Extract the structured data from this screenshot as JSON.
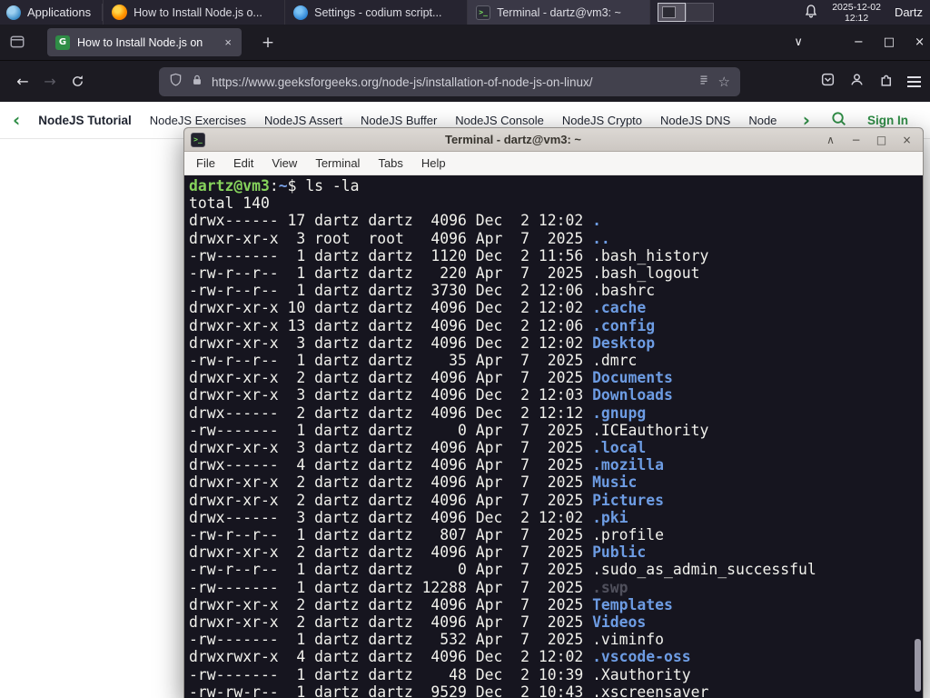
{
  "colors": {
    "gfg_green": "#2f8d46",
    "dir_blue": "#6d9ce3",
    "prompt_green": "#86d35c",
    "firefox_orange": "#ff9500",
    "terminal_bg": "#16151f"
  },
  "panel": {
    "applications": "Applications",
    "tasks": [
      {
        "title": "How to Install Node.js o...",
        "icon": "firefox"
      },
      {
        "title": "Settings - codium script...",
        "icon": "codium"
      },
      {
        "title": "Terminal - dartz@vm3: ~",
        "icon": "terminal"
      }
    ],
    "clock": {
      "date": "2025-12-02",
      "time": "12:12"
    },
    "user": "Dartz"
  },
  "browser": {
    "tab": {
      "title": "How to Install Node.js on",
      "close": "×"
    },
    "new_tab": "+",
    "window_controls": {
      "list_tabs": "∨",
      "minimize": "−",
      "maximize": "□",
      "close": "×"
    },
    "nav": {
      "back": "←",
      "forward": "→"
    },
    "url": "https://www.geeksforgeeks.org/node-js/installation-of-node-js-on-linux/",
    "star": "☆"
  },
  "gfg": {
    "chevron_left": "‹",
    "chevron_right": "›",
    "items": [
      {
        "label": "NodeJS Tutorial",
        "bold": true
      },
      {
        "label": "NodeJS Exercises"
      },
      {
        "label": "NodeJS Assert"
      },
      {
        "label": "NodeJS Buffer"
      },
      {
        "label": "NodeJS Console"
      },
      {
        "label": "NodeJS Crypto"
      },
      {
        "label": "NodeJS DNS"
      },
      {
        "label": "Node"
      }
    ],
    "sign_in": "Sign In"
  },
  "terminal": {
    "title": "Terminal - dartz@vm3: ~",
    "window_buttons": {
      "shade": "∧",
      "minimize": "−",
      "maximize": "□",
      "close": "×"
    },
    "menu": [
      "File",
      "Edit",
      "View",
      "Terminal",
      "Tabs",
      "Help"
    ],
    "prompt": {
      "user": "dartz@vm3",
      "colon": ":",
      "path": "~",
      "dollar": "$ ",
      "command": "ls -la"
    },
    "total": "total 140",
    "entries": [
      {
        "m": "drwx------ 17 dartz dartz  4096 Dec  2 12:02 ",
        "n": ".",
        "k": "dir"
      },
      {
        "m": "drwxr-xr-x  3 root  root   4096 Apr  7  2025 ",
        "n": "..",
        "k": "dir"
      },
      {
        "m": "-rw-------  1 dartz dartz  1120 Dec  2 11:56 ",
        "n": ".bash_history",
        "k": "file"
      },
      {
        "m": "-rw-r--r--  1 dartz dartz   220 Apr  7  2025 ",
        "n": ".bash_logout",
        "k": "file"
      },
      {
        "m": "-rw-r--r--  1 dartz dartz  3730 Dec  2 12:06 ",
        "n": ".bashrc",
        "k": "file"
      },
      {
        "m": "drwxr-xr-x 10 dartz dartz  4096 Dec  2 12:02 ",
        "n": ".cache",
        "k": "dir"
      },
      {
        "m": "drwxr-xr-x 13 dartz dartz  4096 Dec  2 12:06 ",
        "n": ".config",
        "k": "dir"
      },
      {
        "m": "drwxr-xr-x  3 dartz dartz  4096 Dec  2 12:02 ",
        "n": "Desktop",
        "k": "dir"
      },
      {
        "m": "-rw-r--r--  1 dartz dartz    35 Apr  7  2025 ",
        "n": ".dmrc",
        "k": "file"
      },
      {
        "m": "drwxr-xr-x  2 dartz dartz  4096 Apr  7  2025 ",
        "n": "Documents",
        "k": "dir"
      },
      {
        "m": "drwxr-xr-x  3 dartz dartz  4096 Dec  2 12:03 ",
        "n": "Downloads",
        "k": "dir"
      },
      {
        "m": "drwx------  2 dartz dartz  4096 Dec  2 12:12 ",
        "n": ".gnupg",
        "k": "dir"
      },
      {
        "m": "-rw-------  1 dartz dartz     0 Apr  7  2025 ",
        "n": ".ICEauthority",
        "k": "file"
      },
      {
        "m": "drwxr-xr-x  3 dartz dartz  4096 Apr  7  2025 ",
        "n": ".local",
        "k": "dir"
      },
      {
        "m": "drwx------  4 dartz dartz  4096 Apr  7  2025 ",
        "n": ".mozilla",
        "k": "dir"
      },
      {
        "m": "drwxr-xr-x  2 dartz dartz  4096 Apr  7  2025 ",
        "n": "Music",
        "k": "dir"
      },
      {
        "m": "drwxr-xr-x  2 dartz dartz  4096 Apr  7  2025 ",
        "n": "Pictures",
        "k": "dir"
      },
      {
        "m": "drwx------  3 dartz dartz  4096 Dec  2 12:02 ",
        "n": ".pki",
        "k": "dir"
      },
      {
        "m": "-rw-r--r--  1 dartz dartz   807 Apr  7  2025 ",
        "n": ".profile",
        "k": "file"
      },
      {
        "m": "drwxr-xr-x  2 dartz dartz  4096 Apr  7  2025 ",
        "n": "Public",
        "k": "dir"
      },
      {
        "m": "-rw-r--r--  1 dartz dartz     0 Apr  7  2025 ",
        "n": ".sudo_as_admin_successful",
        "k": "file"
      },
      {
        "m": "-rw-------  1 dartz dartz 12288 Apr  7  2025 ",
        "n": ".swp",
        "k": "dim"
      },
      {
        "m": "drwxr-xr-x  2 dartz dartz  4096 Apr  7  2025 ",
        "n": "Templates",
        "k": "dir"
      },
      {
        "m": "drwxr-xr-x  2 dartz dartz  4096 Apr  7  2025 ",
        "n": "Videos",
        "k": "dir"
      },
      {
        "m": "-rw-------  1 dartz dartz   532 Apr  7  2025 ",
        "n": ".viminfo",
        "k": "file"
      },
      {
        "m": "drwxrwxr-x  4 dartz dartz  4096 Dec  2 12:02 ",
        "n": ".vscode-oss",
        "k": "dir"
      },
      {
        "m": "-rw-------  1 dartz dartz    48 Dec  2 10:39 ",
        "n": ".Xauthority",
        "k": "file"
      },
      {
        "m": "-rw-rw-r--  1 dartz dartz  9529 Dec  2 10:43 ",
        "n": ".xscreensaver",
        "k": "file"
      }
    ]
  }
}
